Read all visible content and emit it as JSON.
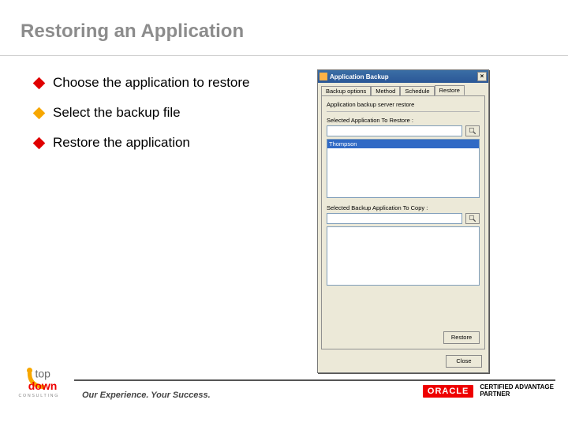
{
  "slide": {
    "title": "Restoring an Application",
    "bullets": [
      {
        "text": "Choose the application to restore",
        "color": "#e00000"
      },
      {
        "text": "Select the backup file",
        "color": "#f7a700"
      },
      {
        "text": "Restore the application",
        "color": "#e00000"
      }
    ]
  },
  "dialog": {
    "title": "Application Backup",
    "close_glyph": "×",
    "tabs": [
      "Backup options",
      "Method",
      "Schedule",
      "Restore"
    ],
    "active_tab_index": 3,
    "panel_heading": "Application backup server restore",
    "app_label": "Selected Application To Restore :",
    "app_value": "",
    "app_list_items": [
      "Thompson"
    ],
    "copy_label": "Selected Backup Application To Copy :",
    "copy_value": "",
    "restore_button": "Restore",
    "close_button": "Close"
  },
  "footer": {
    "tagline": "Our Experience. Your Success.",
    "logo_primary": "top",
    "logo_secondary": "down",
    "logo_tert": "CONSULTING",
    "oracle": "ORACLE",
    "cert1": "CERTIFIED ADVANTAGE",
    "cert2": "PARTNER"
  }
}
